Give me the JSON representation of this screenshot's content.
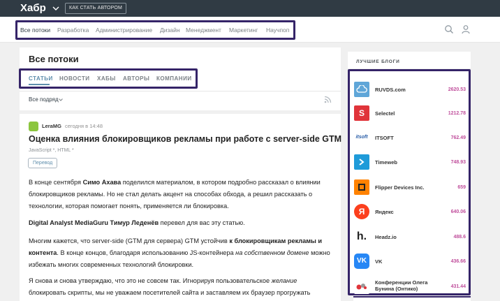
{
  "topbar": {
    "logo": "Хабр",
    "author_button": "КАК СТАТЬ АВТОРОМ"
  },
  "nav": {
    "items": [
      {
        "label": "Все потоки",
        "active": true
      },
      {
        "label": "Разработка"
      },
      {
        "label": "Администрирование"
      },
      {
        "label": "Дизайн"
      },
      {
        "label": "Менеджмент"
      },
      {
        "label": "Маркетинг"
      },
      {
        "label": "Научпоп"
      }
    ],
    "icons": [
      "search-icon",
      "user-icon"
    ]
  },
  "main": {
    "title": "Все потоки",
    "tabs": [
      "СТАТЬИ",
      "НОВОСТИ",
      "ХАБЫ",
      "АВТОРЫ",
      "КОМПАНИИ"
    ],
    "filter_label": "Все подряд"
  },
  "article": {
    "author": "LeraMG",
    "time": "сегодня в 14:48",
    "title": "Оценка влияния блокировщиков рекламы при работе с server-side GTM",
    "hubs": "JavaScript *, HTML *",
    "badge": "Перевод",
    "p1": {
      "a": "В конце сентября ",
      "b": "Симо Ахава",
      "c": " поделился материалом, в котором подробно рассказал о влиянии блокировщиков рекламы. Но не стал делать акцент на способах обхода, а решил рассказать о технологии, которая помогает понять, применяется ли блокировка."
    },
    "p2": {
      "a": "Digital Analyst MediaGuru Тимур Леденёв",
      "b": " перевел для вас эту статью."
    },
    "p3": {
      "a": "Многим кажется, что server-side (GTM для сервера) GTM устойчив ",
      "b": "к блокировщикам рекламы и контента",
      "c": ". В конце концов, благодаря использованию JS-контейнера ",
      "d": "на собственном домене",
      "e": " можно избежать многих современных технологий блокировки."
    },
    "p4": {
      "a": "Я снова и снова утверждаю, что это не совсем так. Игнорируя пользовательское ",
      "b": "желание",
      "c": " блокировать скрипты, мы не уважаем посетителей сайта и заставляем их браузер прогружать"
    }
  },
  "sidebar": {
    "header": "ЛУЧШИЕ БЛОГИ",
    "blogs": [
      {
        "name": "RUVDS.com",
        "rating": "2620.53",
        "icon": "cloud-icon",
        "color": "#5fa6d8"
      },
      {
        "name": "Selectel",
        "rating": "1212.78",
        "icon": "selectel-logo-icon",
        "color": "#e0343a"
      },
      {
        "name": "ITSOFT",
        "rating": "762.49",
        "icon": "itsoft-logo-icon",
        "color": "#2a5ea8"
      },
      {
        "name": "Timeweb",
        "rating": "748.93",
        "icon": "arrow-right-icon",
        "color": "#1f9bd9"
      },
      {
        "name": "Flipper Devices Inc.",
        "rating": "659",
        "icon": "flipper-logo-icon",
        "color": "#ff8200"
      },
      {
        "name": "Яндекс",
        "rating": "640.06",
        "icon": "yandex-logo-icon",
        "color": "#fc3f1d"
      },
      {
        "name": "Headz.io",
        "rating": "488.6",
        "icon": "headz-logo-icon",
        "color": "#222222"
      },
      {
        "name": "VK",
        "rating": "436.66",
        "icon": "vk-logo-icon",
        "color": "#2787f5"
      },
      {
        "name": "Конференции Олега Бунина (Онтико)",
        "rating": "431.44",
        "icon": "ontico-logo-icon",
        "color": "#e0343a"
      }
    ]
  }
}
